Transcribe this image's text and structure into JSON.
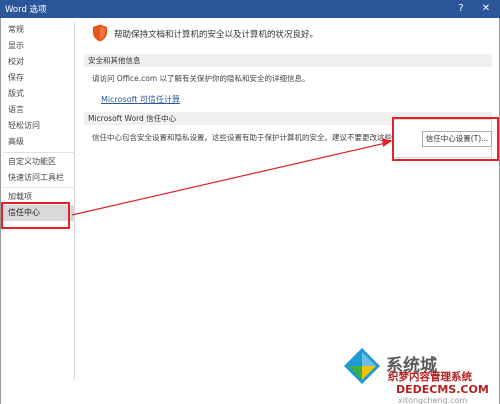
{
  "window": {
    "title": "Word 选项",
    "help_glyph": "?",
    "close_glyph": "✕"
  },
  "sidebar": {
    "items": [
      {
        "label": "常规"
      },
      {
        "label": "显示"
      },
      {
        "label": "校对"
      },
      {
        "label": "保存"
      },
      {
        "label": "版式"
      },
      {
        "label": "语言"
      },
      {
        "label": "轻松访问"
      },
      {
        "label": "高级"
      },
      {
        "label": "自定义功能区"
      },
      {
        "label": "快速访问工具栏"
      },
      {
        "label": "加载项"
      },
      {
        "label": "信任中心"
      }
    ],
    "selected": "信任中心"
  },
  "content": {
    "intro": "帮助保持文档和计算机的安全以及计算机的状况良好。",
    "privacy_section": {
      "header": "安全和其他信息",
      "text": "请访问 Office.com 以了解有关保护你的隐私和安全的详细信息。",
      "link": "Microsoft 可信任计算"
    },
    "trust_center_section": {
      "header": "Microsoft Word 信任中心",
      "text": "信任中心包含安全设置和隐私设置。这些设置有助于保护计算机的安全。建议不要更改这些设置。",
      "button": "信任中心设置(T)..."
    }
  },
  "watermark": {
    "brand": "系统城",
    "line2": "织梦内容管理系统",
    "line3": "DEDECMS.COM",
    "line4": "xitongcheng.com"
  },
  "colors": {
    "titlebar": "#2b579a",
    "highlight": "#e2232b",
    "link": "#2b579a",
    "shield": "#e8531f"
  }
}
